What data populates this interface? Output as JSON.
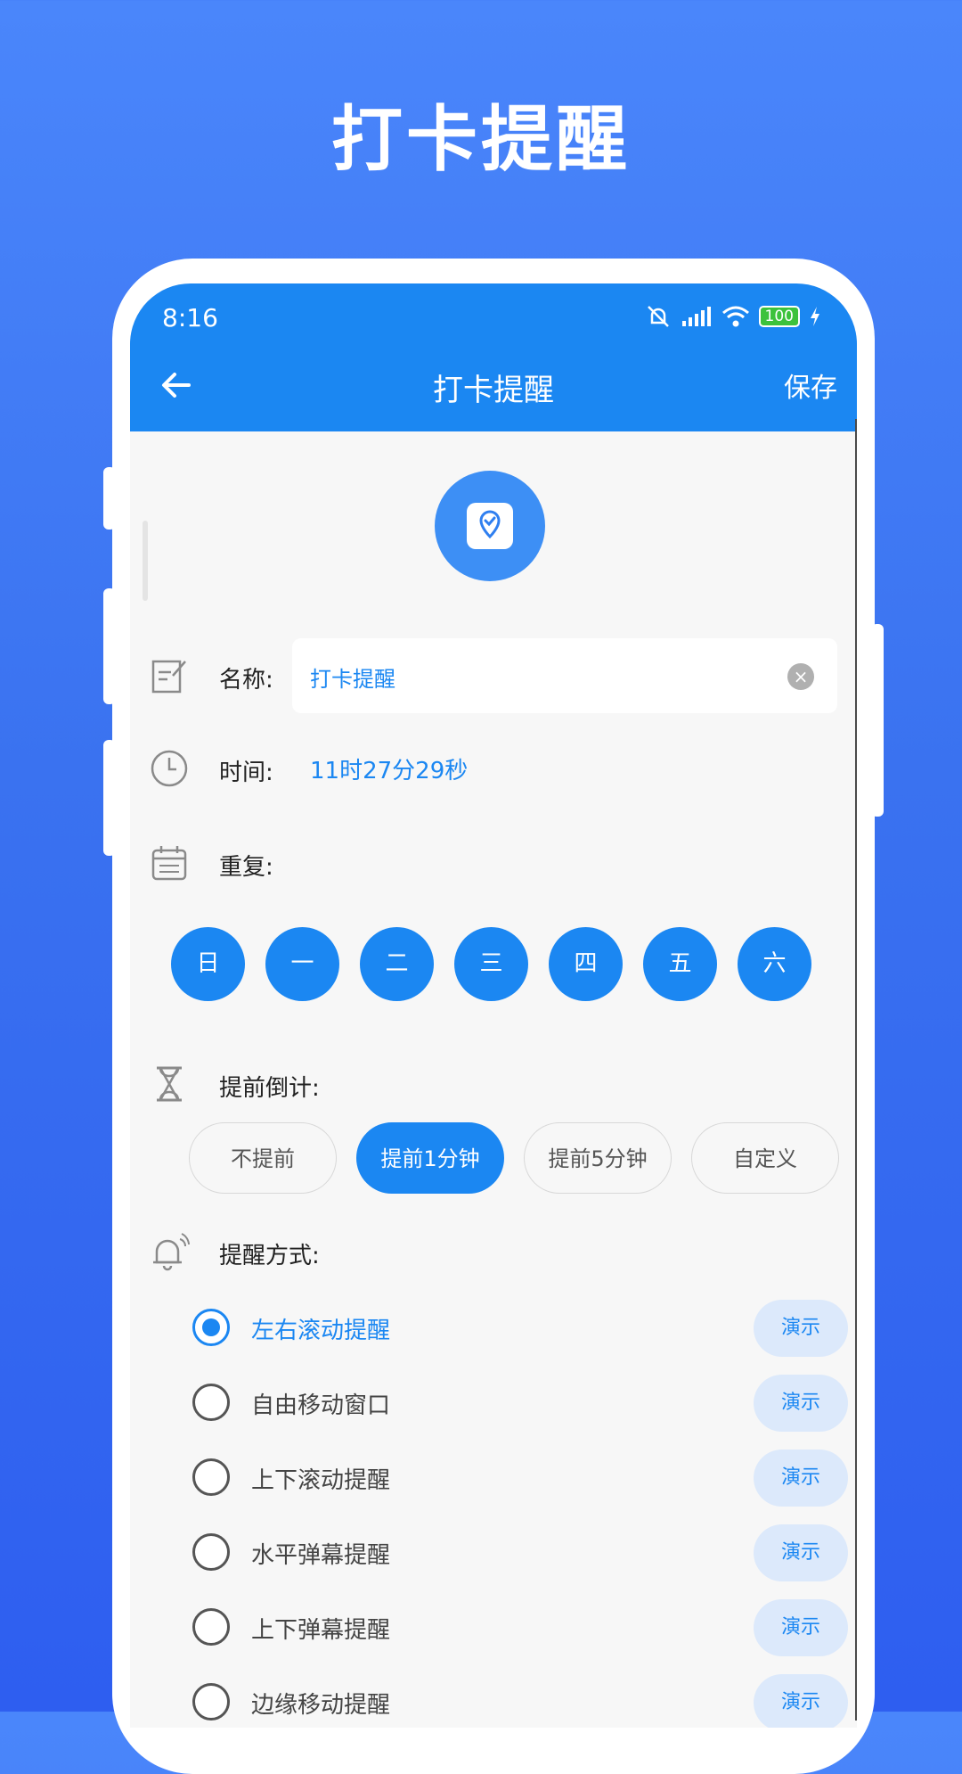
{
  "hero": {
    "title": "打卡提醒"
  },
  "status_bar": {
    "time": "8:16",
    "battery": "100"
  },
  "app_bar": {
    "title": "打卡提醒",
    "save_label": "保存"
  },
  "form": {
    "name_label": "名称:",
    "name_value": "打卡提醒",
    "time_label": "时间:",
    "time_value": "11时27分29秒",
    "repeat_label": "重复:",
    "weekdays": [
      "日",
      "一",
      "二",
      "三",
      "四",
      "五",
      "六"
    ],
    "advance_label": "提前倒计:",
    "advance_options": [
      "不提前",
      "提前1分钟",
      "提前5分钟",
      "自定义"
    ],
    "advance_selected": "提前1分钟",
    "method_label": "提醒方式:",
    "demo_label": "演示",
    "methods": [
      "左右滚动提醒",
      "自由移动窗口",
      "上下滚动提醒",
      "水平弹幕提醒",
      "上下弹幕提醒",
      "边缘移动提醒"
    ],
    "method_selected": "左右滚动提醒"
  },
  "colors": {
    "accent": "#1b87f2",
    "background": "#3a72f0",
    "demo_bg": "#dce9fb"
  },
  "icons": [
    "back-arrow-icon",
    "mute-bell-icon",
    "signal-icon",
    "wifi-icon",
    "battery-icon",
    "charging-icon",
    "location-check-icon",
    "edit-note-icon",
    "clock-icon",
    "calendar-icon",
    "hourglass-icon",
    "bell-ring-icon"
  ]
}
